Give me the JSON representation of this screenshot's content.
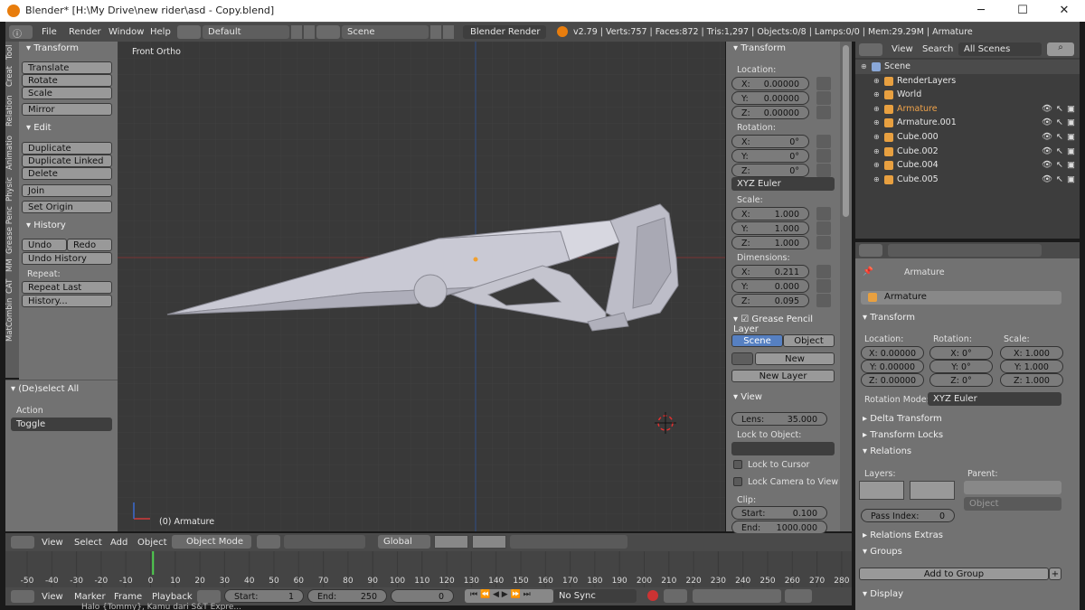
{
  "window": {
    "title": "Blender* [H:\\My Drive\\new rider\\asd - Copy.blend]",
    "min": "─",
    "max": "☐",
    "close": "✕"
  },
  "topbar": {
    "menus": [
      "File",
      "Render",
      "Window",
      "Help"
    ],
    "layout": "Default",
    "scene": "Scene",
    "engine": "Blender Render",
    "stats": "v2.79 | Verts:757 | Faces:872 | Tris:1,297 | Objects:0/8 | Lamps:0/0 | Mem:29.29M | Armature"
  },
  "tool_tabs": [
    "Tool",
    "Creat",
    "Relation",
    "Animatio",
    "Physic",
    "Grease Penc",
    "MM",
    "CAT",
    "MatCombine"
  ],
  "tool_shelf": {
    "transform": {
      "title": "Transform",
      "buttons": [
        "Translate",
        "Rotate",
        "Scale",
        "Mirror"
      ]
    },
    "edit": {
      "title": "Edit",
      "buttons": [
        "Duplicate",
        "Duplicate Linked",
        "Delete",
        "Join"
      ],
      "set_origin": "Set Origin"
    },
    "history": {
      "title": "History",
      "undo": "Undo",
      "redo": "Redo",
      "undo_history": "Undo History",
      "repeat": "Repeat:",
      "repeat_last": "Repeat Last",
      "history_btn": "History..."
    },
    "operator": {
      "title": "(De)select All",
      "action_label": "Action",
      "action_value": "Toggle"
    }
  },
  "viewport": {
    "view_name": "Front Ortho",
    "active": "(0) Armature"
  },
  "npanel": {
    "transform_title": "Transform",
    "location_label": "Location:",
    "location": [
      {
        "axis": "X:",
        "value": "0.00000"
      },
      {
        "axis": "Y:",
        "value": "0.00000"
      },
      {
        "axis": "Z:",
        "value": "0.00000"
      }
    ],
    "rotation_label": "Rotation:",
    "rotation": [
      {
        "axis": "X:",
        "value": "0°"
      },
      {
        "axis": "Y:",
        "value": "0°"
      },
      {
        "axis": "Z:",
        "value": "0°"
      }
    ],
    "rotation_mode": "XYZ Euler",
    "scale_label": "Scale:",
    "scale": [
      {
        "axis": "X:",
        "value": "1.000"
      },
      {
        "axis": "Y:",
        "value": "1.000"
      },
      {
        "axis": "Z:",
        "value": "1.000"
      }
    ],
    "dimensions_label": "Dimensions:",
    "dimensions": [
      {
        "axis": "X:",
        "value": "0.211"
      },
      {
        "axis": "Y:",
        "value": "0.000"
      },
      {
        "axis": "Z:",
        "value": "0.095"
      }
    ],
    "grease_title": "Grease Pencil Layer",
    "gp_scene": "Scene",
    "gp_object": "Object",
    "gp_new": "New",
    "gp_new_layer": "New Layer",
    "view_title": "View",
    "lens_label": "Lens:",
    "lens_value": "35.000",
    "lock_to_object": "Lock to Object:",
    "lock_cursor": "Lock to Cursor",
    "lock_camera": "Lock Camera to View",
    "clip_label": "Clip:",
    "clip_start_label": "Start:",
    "clip_start": "0.100",
    "clip_end_label": "End:",
    "clip_end": "1000.000"
  },
  "outliner": {
    "view": "View",
    "search": "Search",
    "filter": "All Scenes",
    "items": [
      {
        "name": "Scene",
        "indent": 0,
        "color": "#e6e6e6"
      },
      {
        "name": "RenderLayers",
        "indent": 1,
        "color": "#e6e6e6"
      },
      {
        "name": "World",
        "indent": 1,
        "color": "#e6e6e6"
      },
      {
        "name": "Armature",
        "indent": 1,
        "color": "#f0a34a"
      },
      {
        "name": "Armature.001",
        "indent": 1,
        "color": "#e6e6e6"
      },
      {
        "name": "Cube.000",
        "indent": 1,
        "color": "#e6e6e6"
      },
      {
        "name": "Cube.002",
        "indent": 1,
        "color": "#e6e6e6"
      },
      {
        "name": "Cube.004",
        "indent": 1,
        "color": "#e6e6e6"
      },
      {
        "name": "Cube.005",
        "indent": 1,
        "color": "#e6e6e6"
      }
    ]
  },
  "properties": {
    "breadcrumb": "Armature",
    "object_name": "Armature",
    "transform_title": "Transform",
    "location_label": "Location:",
    "rotation_label": "Rotation:",
    "scale_label": "Scale:",
    "loc": [
      "X: 0.00000",
      "Y: 0.00000",
      "Z: 0.00000"
    ],
    "rot": [
      "X: 0°",
      "Y: 0°",
      "Z: 0°"
    ],
    "scl": [
      "X: 1.000",
      "Y: 1.000",
      "Z: 1.000"
    ],
    "rotation_mode_label": "Rotation Mode:",
    "rotation_mode": "XYZ Euler",
    "delta": "Delta Transform",
    "locks": "Transform Locks",
    "relations": "Relations",
    "layers": "Layers:",
    "parent": "Parent:",
    "parent_type": "Object",
    "pass_index_label": "Pass Index:",
    "pass_index": "0",
    "relations_extras": "Relations Extras",
    "groups": "Groups",
    "add_to_group": "Add to Group",
    "display": "Display"
  },
  "viewport_header": {
    "menus": [
      "View",
      "Select",
      "Add",
      "Object"
    ],
    "mode": "Object Mode",
    "orientation": "Global"
  },
  "timeline": {
    "ticks": [
      "-50",
      "-40",
      "-30",
      "-20",
      "-10",
      "0",
      "10",
      "20",
      "30",
      "40",
      "50",
      "60",
      "70",
      "80",
      "90",
      "100",
      "110",
      "120",
      "130",
      "140",
      "150",
      "160",
      "170",
      "180",
      "190",
      "200",
      "210",
      "220",
      "230",
      "240",
      "250",
      "260",
      "270",
      "280"
    ],
    "current_frame": 1
  },
  "timeline_header": {
    "menus": [
      "View",
      "Marker",
      "Frame",
      "Playback"
    ],
    "start_label": "Start:",
    "start": "1",
    "end_label": "End:",
    "end": "250",
    "current": "0",
    "sync": "No Sync"
  },
  "taskbar_snippet": "Halo {Tommy}, Kamu dari S&T Expre..."
}
